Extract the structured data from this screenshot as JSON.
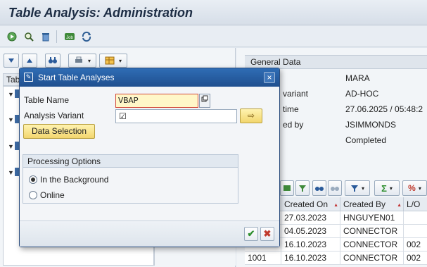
{
  "window": {
    "title": "Table Analysis: Administration"
  },
  "app_toolbar": {
    "icons": [
      "execute-icon",
      "find-icon",
      "delete-icon",
      "job-icon",
      "refresh-icon"
    ],
    "job_label": "Job"
  },
  "left_pane": {
    "tree_header_label": "Tab"
  },
  "general_data": {
    "header": "General Data",
    "rows": [
      {
        "label": "",
        "value": "MARA"
      },
      {
        "label": "variant",
        "value": "AD-HOC"
      },
      {
        "label": "time",
        "value": "27.06.2025 / 05:48:2"
      },
      {
        "label": "ed by",
        "value": "JSIMMONDS"
      },
      {
        "label": "",
        "value": "Completed"
      }
    ]
  },
  "table": {
    "columns": [
      "Created On",
      "Created By",
      "L/O"
    ],
    "rows": [
      {
        "lead": "",
        "created_on": "27.03.2023",
        "created_by": "HNGUYEN01",
        "lo": ""
      },
      {
        "lead": "",
        "created_on": "04.05.2023",
        "created_by": "CONNECTOR",
        "lo": ""
      },
      {
        "lead": "",
        "created_on": "16.10.2023",
        "created_by": "CONNECTOR",
        "lo": "002"
      },
      {
        "lead": "1001",
        "created_on": "16.10.2023",
        "created_by": "CONNECTOR",
        "lo": "002"
      }
    ]
  },
  "dialog": {
    "title": "Start Table Analyses",
    "table_name_label": "Table Name",
    "table_name_value": "VBAP",
    "analysis_variant_label": "Analysis Variant",
    "analysis_variant_value": "☑",
    "data_selection_label": "Data Selection",
    "processing_header": "Processing Options",
    "opt_background": "In the Background",
    "opt_online": "Online",
    "selected_option": "background",
    "close_glyph": "×",
    "ok_glyph": "✔",
    "cancel_glyph": "✖",
    "next_glyph": "⇨"
  },
  "colors": {
    "dialog_title_bg": "#2f6db5",
    "input_highlight": "#fff7c8",
    "input_border_error": "#d24a3a"
  }
}
